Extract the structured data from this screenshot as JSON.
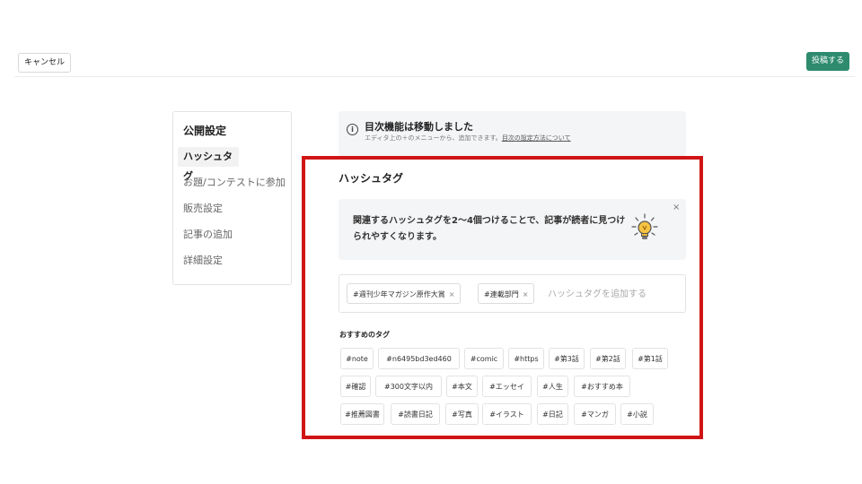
{
  "toolbar": {
    "cancel_label": "キャンセル",
    "post_label": "投稿する",
    "post_color": "#2e8b6e"
  },
  "sidebar": {
    "title": "公開設定",
    "items": [
      {
        "label": "ハッシュタグ",
        "active": true
      },
      {
        "label": "お題/コンテストに参加",
        "active": false
      },
      {
        "label": "販売設定",
        "active": false
      },
      {
        "label": "記事の追加",
        "active": false
      },
      {
        "label": "詳細設定",
        "active": false
      }
    ]
  },
  "notice": {
    "icon": "info-icon",
    "title": "目次機能は移動しました",
    "desc": "エディタ上の＋のメニューから、追加できます。",
    "link": "目次の設定方法について"
  },
  "hashtag_panel": {
    "title": "ハッシュタグ",
    "highlight_color": "#d01414",
    "hint_text": "関連するハッシュタグを2〜4個つけることで、記事が読者に見つけられやすくなります。",
    "hint_icon": "lightbulb-icon",
    "close_glyph": "×",
    "selected_tags": [
      {
        "label": "#週刊少年マガジン原作大賞",
        "remove": "×"
      },
      {
        "label": "#連載部門",
        "remove": "×"
      }
    ],
    "input_placeholder": "ハッシュタグを追加する",
    "recommended_label": "おすすめのタグ",
    "recommended_tags": [
      "#note",
      "#n6495bd3ed460",
      "#comic",
      "#https",
      "#第3話",
      "#第2話",
      "#第1話",
      "#確認",
      "#300文字以内",
      "#本文",
      "#エッセイ",
      "#人生",
      "#おすすめ本",
      "#推薦図書",
      "#読書日記",
      "#写真",
      "#イラスト",
      "#日記",
      "#マンガ",
      "#小説"
    ]
  }
}
